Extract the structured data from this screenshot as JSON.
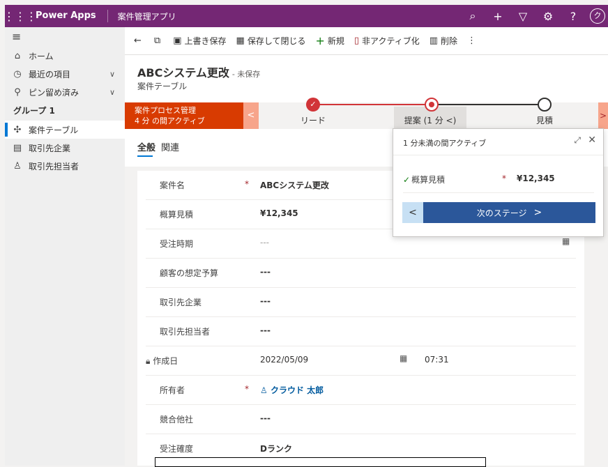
{
  "topbar": {
    "brand": "Power Apps",
    "app_name": "案件管理アプリ",
    "avatar_initial": "ク",
    "icons": [
      "search-icon",
      "plus-icon",
      "filter-icon",
      "settings-icon",
      "help-icon"
    ]
  },
  "sidebar": {
    "items": [
      {
        "label": "ホーム",
        "icon": "home-icon"
      },
      {
        "label": "最近の項目",
        "icon": "clock-icon"
      },
      {
        "label": "ピン留め済み",
        "icon": "pin-icon"
      }
    ],
    "group_title": "グループ 1",
    "group_items": [
      {
        "label": "案件テーブル",
        "icon": "puzzle-icon",
        "selected": true
      },
      {
        "label": "取引先企業",
        "icon": "building-icon"
      },
      {
        "label": "取引先担当者",
        "icon": "person-icon"
      }
    ]
  },
  "commands": {
    "save": "上書き保存",
    "save_close": "保存して閉じる",
    "new": "新規",
    "deactivate": "非アクティブ化",
    "delete": "削除"
  },
  "header": {
    "title": "ABCシステム更改",
    "unsaved": "- 未保存",
    "entity": "案件テーブル"
  },
  "bpf": {
    "flyout_title": "案件プロセス管理",
    "flyout_sub": "4 分 の間アクティブ",
    "stages": [
      {
        "label": "リード",
        "state": "completed"
      },
      {
        "label": "提案 (1 分 <)",
        "state": "active"
      },
      {
        "label": "見積",
        "state": "pending"
      }
    ]
  },
  "tabs": [
    "全般",
    "関連"
  ],
  "form": {
    "fields": [
      {
        "label": "案件名",
        "required": true,
        "value": "ABCシステム更改"
      },
      {
        "label": "概算見積",
        "required": false,
        "value": "¥12,345"
      },
      {
        "label": "受注時期",
        "required": false,
        "value": "---"
      },
      {
        "label": "顧客の想定予算",
        "required": false,
        "value": "---"
      },
      {
        "label": "取引先企業",
        "required": false,
        "value": "---"
      },
      {
        "label": "取引先担当者",
        "required": false,
        "value": "---"
      },
      {
        "label": "作成日",
        "required": false,
        "value": "2022/05/09",
        "time": "07:31"
      },
      {
        "label": "所有者",
        "required": true,
        "value": "クラウド 太郎"
      },
      {
        "label": "競合他社",
        "required": false,
        "value": "---"
      },
      {
        "label": "受注確度",
        "required": false,
        "value": "Dランク"
      }
    ]
  },
  "popup": {
    "title": "1 分未満の間アクティブ",
    "field_label": "概算見積",
    "field_value": "¥12,345",
    "next_label": "次のステージ"
  }
}
